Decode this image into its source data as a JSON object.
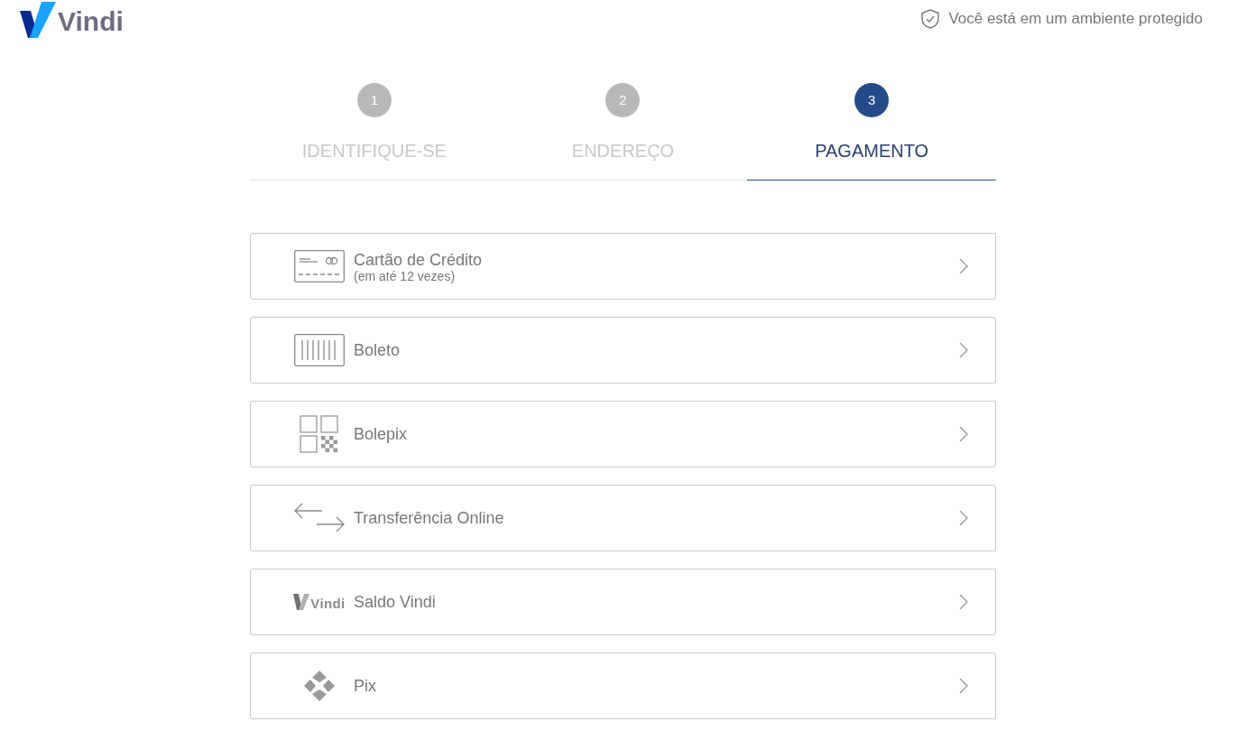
{
  "header": {
    "logo": "Vindi",
    "security_note": "Você está em um ambiente protegido"
  },
  "steps": [
    {
      "number": "1",
      "label": "IDENTIFIQUE-SE",
      "selected": false
    },
    {
      "number": "2",
      "label": "ENDEREÇO",
      "selected": false
    },
    {
      "number": "3",
      "label": "PAGAMENTO",
      "selected": true
    }
  ],
  "payment_methods": [
    {
      "kind": "card",
      "label": "Cartão de Crédito",
      "sublabel": "(em até 12 vezes)"
    },
    {
      "kind": "boleto",
      "label": "Boleto"
    },
    {
      "kind": "bolepix",
      "label": "Bolepix"
    },
    {
      "kind": "transfer",
      "label": "Transferência Online"
    },
    {
      "kind": "vindi",
      "label": "Saldo Vindi",
      "icon_text": "Vindi"
    },
    {
      "kind": "pix",
      "label": "Pix"
    }
  ]
}
